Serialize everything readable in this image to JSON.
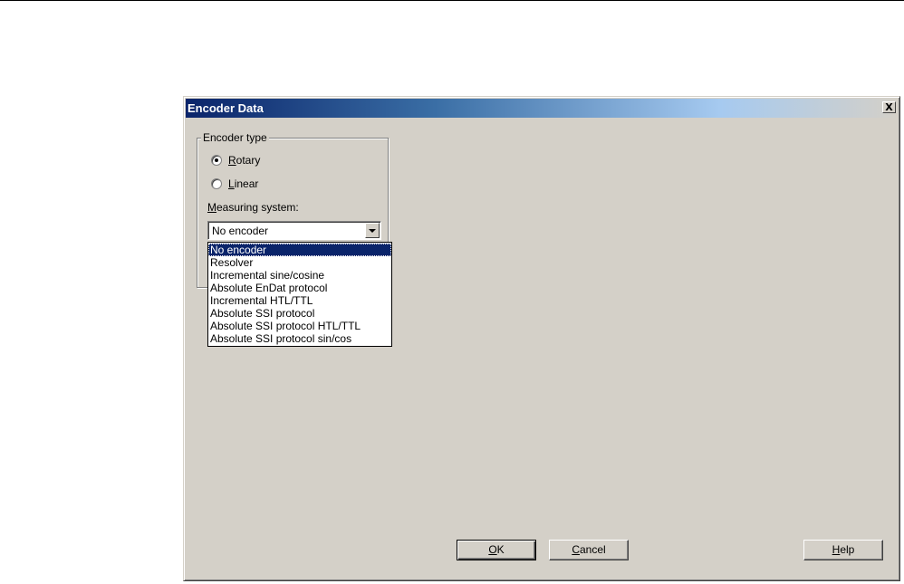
{
  "window": {
    "title": "Encoder Data",
    "close_glyph": "X",
    "close_icon": "close-icon"
  },
  "encoder_type": {
    "group_label": "Encoder type",
    "options": [
      {
        "label_accel": "R",
        "label_rest": "otary",
        "checked": true
      },
      {
        "label_accel": "L",
        "label_rest": "inear",
        "checked": false
      }
    ]
  },
  "measuring_system": {
    "label_accel": "M",
    "label_rest": "easuring system:",
    "selected_value": "No encoder",
    "dropdown_icon": "chevron-down-icon",
    "options": [
      "No encoder",
      "Resolver",
      "Incremental sine/cosine",
      "Absolute EnDat protocol",
      "Incremental HTL/TTL",
      "Absolute SSI protocol",
      "Absolute SSI protocol HTL/TTL",
      "Absolute SSI protocol sin/cos"
    ],
    "highlighted_index": 0
  },
  "buttons": {
    "ok_accel": "O",
    "ok_rest": "K",
    "cancel_accel": "C",
    "cancel_rest": "ancel",
    "help_accel": "H",
    "help_rest": "elp"
  },
  "colors": {
    "dialog_face": "#d4d0c8",
    "title_active": "#0a246a",
    "selection": "#0a246a"
  }
}
